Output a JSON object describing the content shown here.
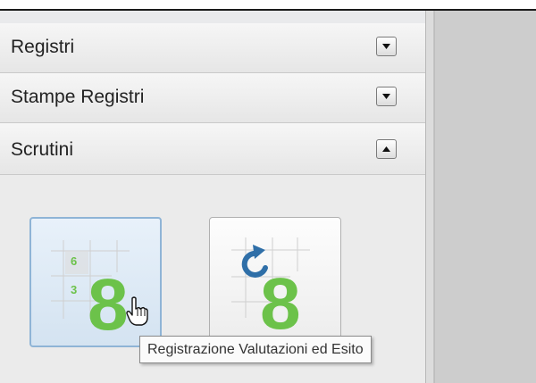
{
  "accordion": {
    "sections": [
      {
        "label": "Registri",
        "state": "collapsed",
        "toggle_icon": "chevron-down-icon"
      },
      {
        "label": "Stampe Registri",
        "state": "collapsed",
        "toggle_icon": "chevron-down-icon"
      },
      {
        "label": "Scrutini",
        "state": "expanded",
        "toggle_icon": "chevron-up-icon"
      }
    ]
  },
  "scrutini": {
    "tiles": [
      {
        "icon": "grade-grid-8-icon",
        "small_digits": [
          "6",
          "3"
        ],
        "big_digit": "8",
        "hovered": true
      },
      {
        "icon": "grade-refresh-8-icon",
        "big_digit": "8",
        "hovered": false
      }
    ]
  },
  "tooltip": {
    "text": "Registrazione Valutazioni ed Esito"
  },
  "colors": {
    "grade_green": "#6cc24a",
    "refresh_blue": "#2f6fa8",
    "hover_border": "#8fb4d6"
  }
}
